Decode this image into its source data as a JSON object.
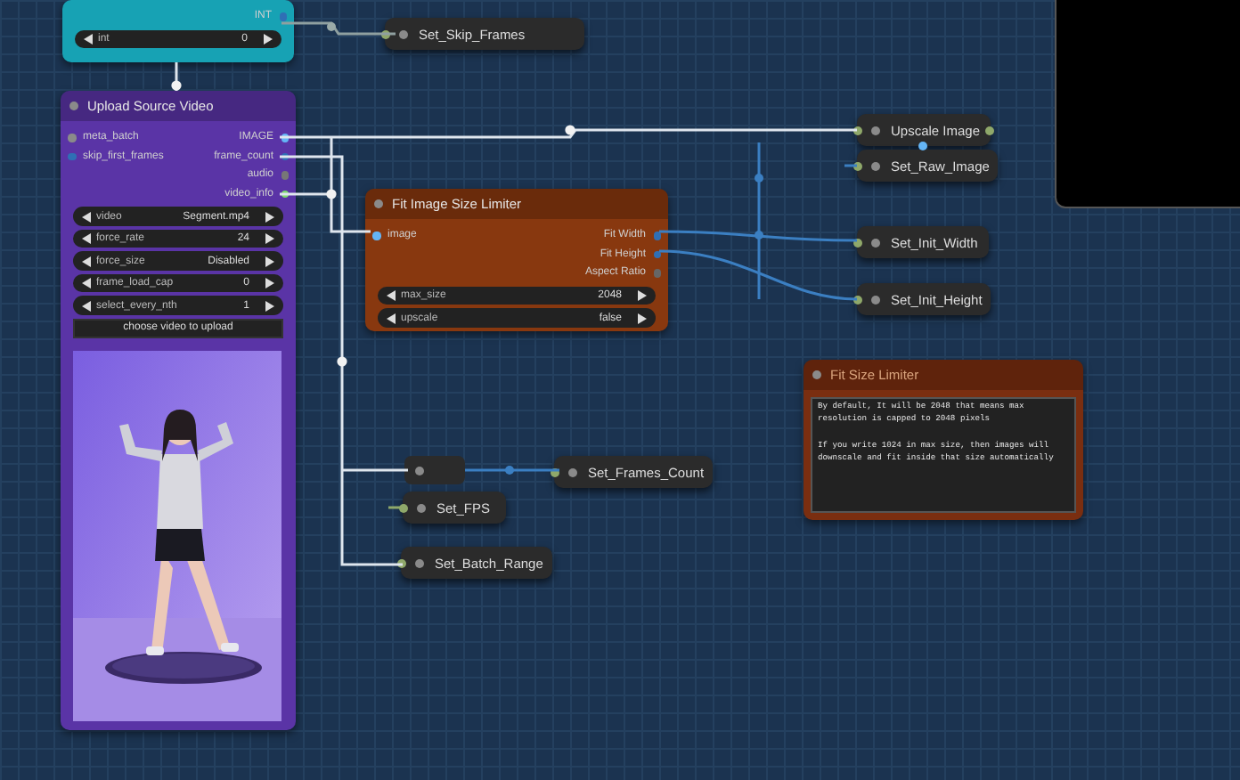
{
  "nodes": [
    {
      "kind": "node",
      "color": "#17a2b4",
      "outputs": [
        {
          "label": "INT",
          "color": "#2f6fb5"
        }
      ],
      "widgets": [
        {
          "label": "int",
          "value": "0"
        }
      ]
    },
    {
      "kind": "setter",
      "title": "Set_Skip_Frames",
      "has_output": false
    },
    {
      "kind": "node",
      "title": "Upload Source Video",
      "color": "#5a34a6",
      "inputs": [
        {
          "label": "meta_batch",
          "color": "#8a8a8a"
        },
        {
          "label": "skip_first_frames",
          "color": "#2f6fb5"
        }
      ],
      "outputs": [
        {
          "label": "IMAGE",
          "color": "#64b5f6"
        },
        {
          "label": "frame_count",
          "color": "#2f6fb5"
        },
        {
          "label": "audio",
          "color": "#777777"
        },
        {
          "label": "video_info",
          "color": "#7cdc6c"
        }
      ],
      "widgets": [
        {
          "label": "video",
          "value": "Segment.mp4"
        },
        {
          "label": "force_rate",
          "value": "24"
        },
        {
          "label": "force_size",
          "value": "Disabled"
        },
        {
          "label": "frame_load_cap",
          "value": "0"
        },
        {
          "label": "select_every_nth",
          "value": "1"
        }
      ],
      "button": "choose video to upload",
      "preview": {
        "kind": "picture"
      }
    },
    {
      "kind": "setter",
      "title": "Upscale Image",
      "has_output": true
    },
    {
      "kind": "setter",
      "title": "Set_Raw_Image",
      "has_output": false
    },
    {
      "kind": "node",
      "title": "Fit Image Size Limiter",
      "color": "#88380f",
      "inputs": [
        {
          "label": "image",
          "color": "#64b5f6"
        }
      ],
      "outputs": [
        {
          "label": "Fit Width",
          "color": "#2f6fb5"
        },
        {
          "label": "Fit Height",
          "color": "#2f6fb5"
        },
        {
          "label": "Aspect Ratio",
          "color": "#666666"
        }
      ],
      "widgets": [
        {
          "label": "max_size",
          "value": "2048"
        },
        {
          "label": "upscale",
          "value": "false"
        }
      ]
    },
    {
      "kind": "setter",
      "title": "Set_Init_Width",
      "has_output": false
    },
    {
      "kind": "setter",
      "title": "Set_Init_Height",
      "has_output": false
    },
    {
      "kind": "note",
      "title": "Fit Size Limiter",
      "color": "#7a2e10",
      "paragraphs": [
        "By default, It will be 2048 that means max resolution is capped to 2048 pixels",
        "If you write 1024 in max size, then images will downscale and fit inside that size automatically"
      ]
    },
    {
      "kind": "setter",
      "title": "Set_Frames_Count",
      "has_output": false
    },
    {
      "kind": "setter",
      "title": "Set_FPS",
      "has_output": false
    },
    {
      "kind": "setter",
      "title": "Set_Batch_Range",
      "has_output": false
    }
  ]
}
